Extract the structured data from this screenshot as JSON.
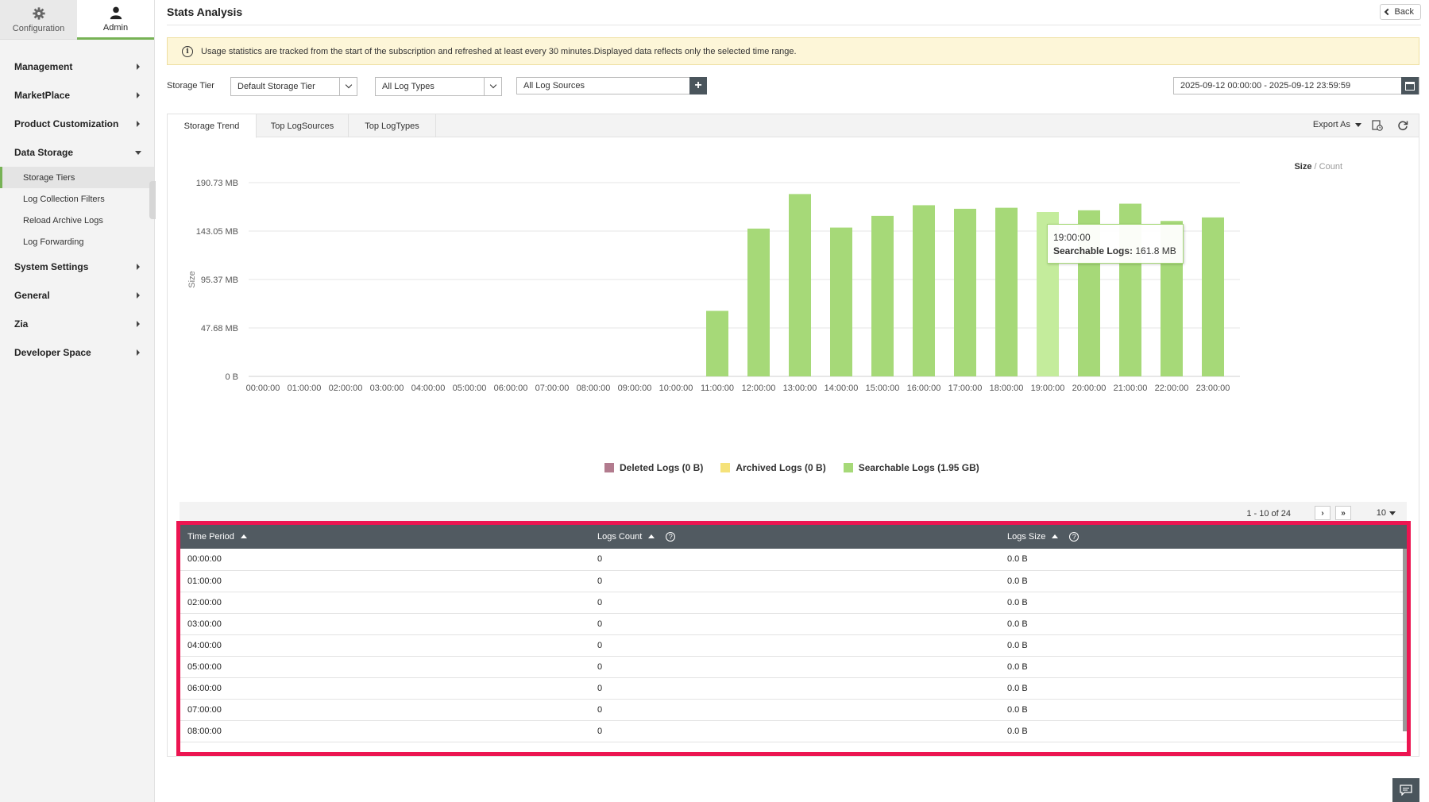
{
  "sidebar": {
    "tabs": [
      {
        "label": "Configuration",
        "icon": "gear-icon"
      },
      {
        "label": "Admin",
        "icon": "user-icon"
      }
    ],
    "nav": [
      {
        "label": "Management"
      },
      {
        "label": "MarketPlace"
      },
      {
        "label": "Product Customization"
      },
      {
        "label": "Data Storage"
      },
      {
        "label": "System Settings"
      },
      {
        "label": "General"
      },
      {
        "label": "Zia"
      },
      {
        "label": "Developer Space"
      }
    ],
    "data_storage_items": [
      {
        "label": "Storage Tiers"
      },
      {
        "label": "Log Collection Filters"
      },
      {
        "label": "Reload Archive Logs"
      },
      {
        "label": "Log Forwarding"
      }
    ]
  },
  "header": {
    "title": "Stats Analysis",
    "back_label": "Back"
  },
  "banner": {
    "text": "Usage statistics are tracked from the start of the subscription and refreshed at least every 30 minutes.Displayed data reflects only the selected time range."
  },
  "filters": {
    "storage_tier_label": "Storage Tier",
    "storage_tier_value": "Default Storage Tier",
    "log_types_value": "All Log Types",
    "log_sources_value": "All Log Sources",
    "date_range": "2025-09-12 00:00:00 - 2025-09-12 23:59:59"
  },
  "tabs": [
    {
      "label": "Storage Trend",
      "active": true
    },
    {
      "label": "Top LogSources"
    },
    {
      "label": "Top LogTypes"
    }
  ],
  "toolbar": {
    "export_label": "Export As",
    "size_label": "Size",
    "separator": " / ",
    "count_label": "Count"
  },
  "chart_data": {
    "type": "bar",
    "ylabel": "Size",
    "ytick_labels": [
      "0 B",
      "47.68 MB",
      "95.37 MB",
      "143.05 MB",
      "190.73 MB"
    ],
    "ytick_values": [
      0,
      47.68,
      95.37,
      143.05,
      190.73
    ],
    "ylim": [
      0,
      190.73
    ],
    "categories": [
      "00:00:00",
      "01:00:00",
      "02:00:00",
      "03:00:00",
      "04:00:00",
      "05:00:00",
      "06:00:00",
      "07:00:00",
      "08:00:00",
      "09:00:00",
      "10:00:00",
      "11:00:00",
      "12:00:00",
      "13:00:00",
      "14:00:00",
      "15:00:00",
      "16:00:00",
      "17:00:00",
      "18:00:00",
      "19:00:00",
      "20:00:00",
      "21:00:00",
      "22:00:00",
      "23:00:00"
    ],
    "series": [
      {
        "name": "Deleted Logs (0 B)",
        "color": "#b27b8e",
        "values": [
          0,
          0,
          0,
          0,
          0,
          0,
          0,
          0,
          0,
          0,
          0,
          0,
          0,
          0,
          0,
          0,
          0,
          0,
          0,
          0,
          0,
          0,
          0,
          0
        ]
      },
      {
        "name": "Archived Logs (0 B)",
        "color": "#f5e27a",
        "values": [
          0,
          0,
          0,
          0,
          0,
          0,
          0,
          0,
          0,
          0,
          0,
          0,
          0,
          0,
          0,
          0,
          0,
          0,
          0,
          0,
          0,
          0,
          0,
          0
        ]
      },
      {
        "name": "Searchable Logs (1.95 GB)",
        "color": "#a6d978",
        "values": [
          0,
          0,
          0,
          0,
          0,
          0,
          0,
          0,
          0,
          0,
          0,
          64.5,
          145.5,
          179.5,
          146.5,
          158,
          168.5,
          165,
          166,
          161.8,
          163.5,
          170,
          153,
          156.5
        ]
      }
    ],
    "highlight_index": 19,
    "highlight_color": "#c4ec9c",
    "grid": true,
    "legend_position": "bottom"
  },
  "tooltip": {
    "time": "19:00:00",
    "label": "Searchable Logs:",
    "value": "161.8 MB"
  },
  "pager": {
    "text": "1 - 10 of 24",
    "page_size": "10"
  },
  "table": {
    "columns": [
      "Time Period",
      "Logs Count",
      "Logs Size"
    ],
    "rows": [
      [
        "00:00:00",
        "0",
        "0.0 B"
      ],
      [
        "01:00:00",
        "0",
        "0.0 B"
      ],
      [
        "02:00:00",
        "0",
        "0.0 B"
      ],
      [
        "03:00:00",
        "0",
        "0.0 B"
      ],
      [
        "04:00:00",
        "0",
        "0.0 B"
      ],
      [
        "05:00:00",
        "0",
        "0.0 B"
      ],
      [
        "06:00:00",
        "0",
        "0.0 B"
      ],
      [
        "07:00:00",
        "0",
        "0.0 B"
      ],
      [
        "08:00:00",
        "0",
        "0.0 B"
      ]
    ]
  }
}
